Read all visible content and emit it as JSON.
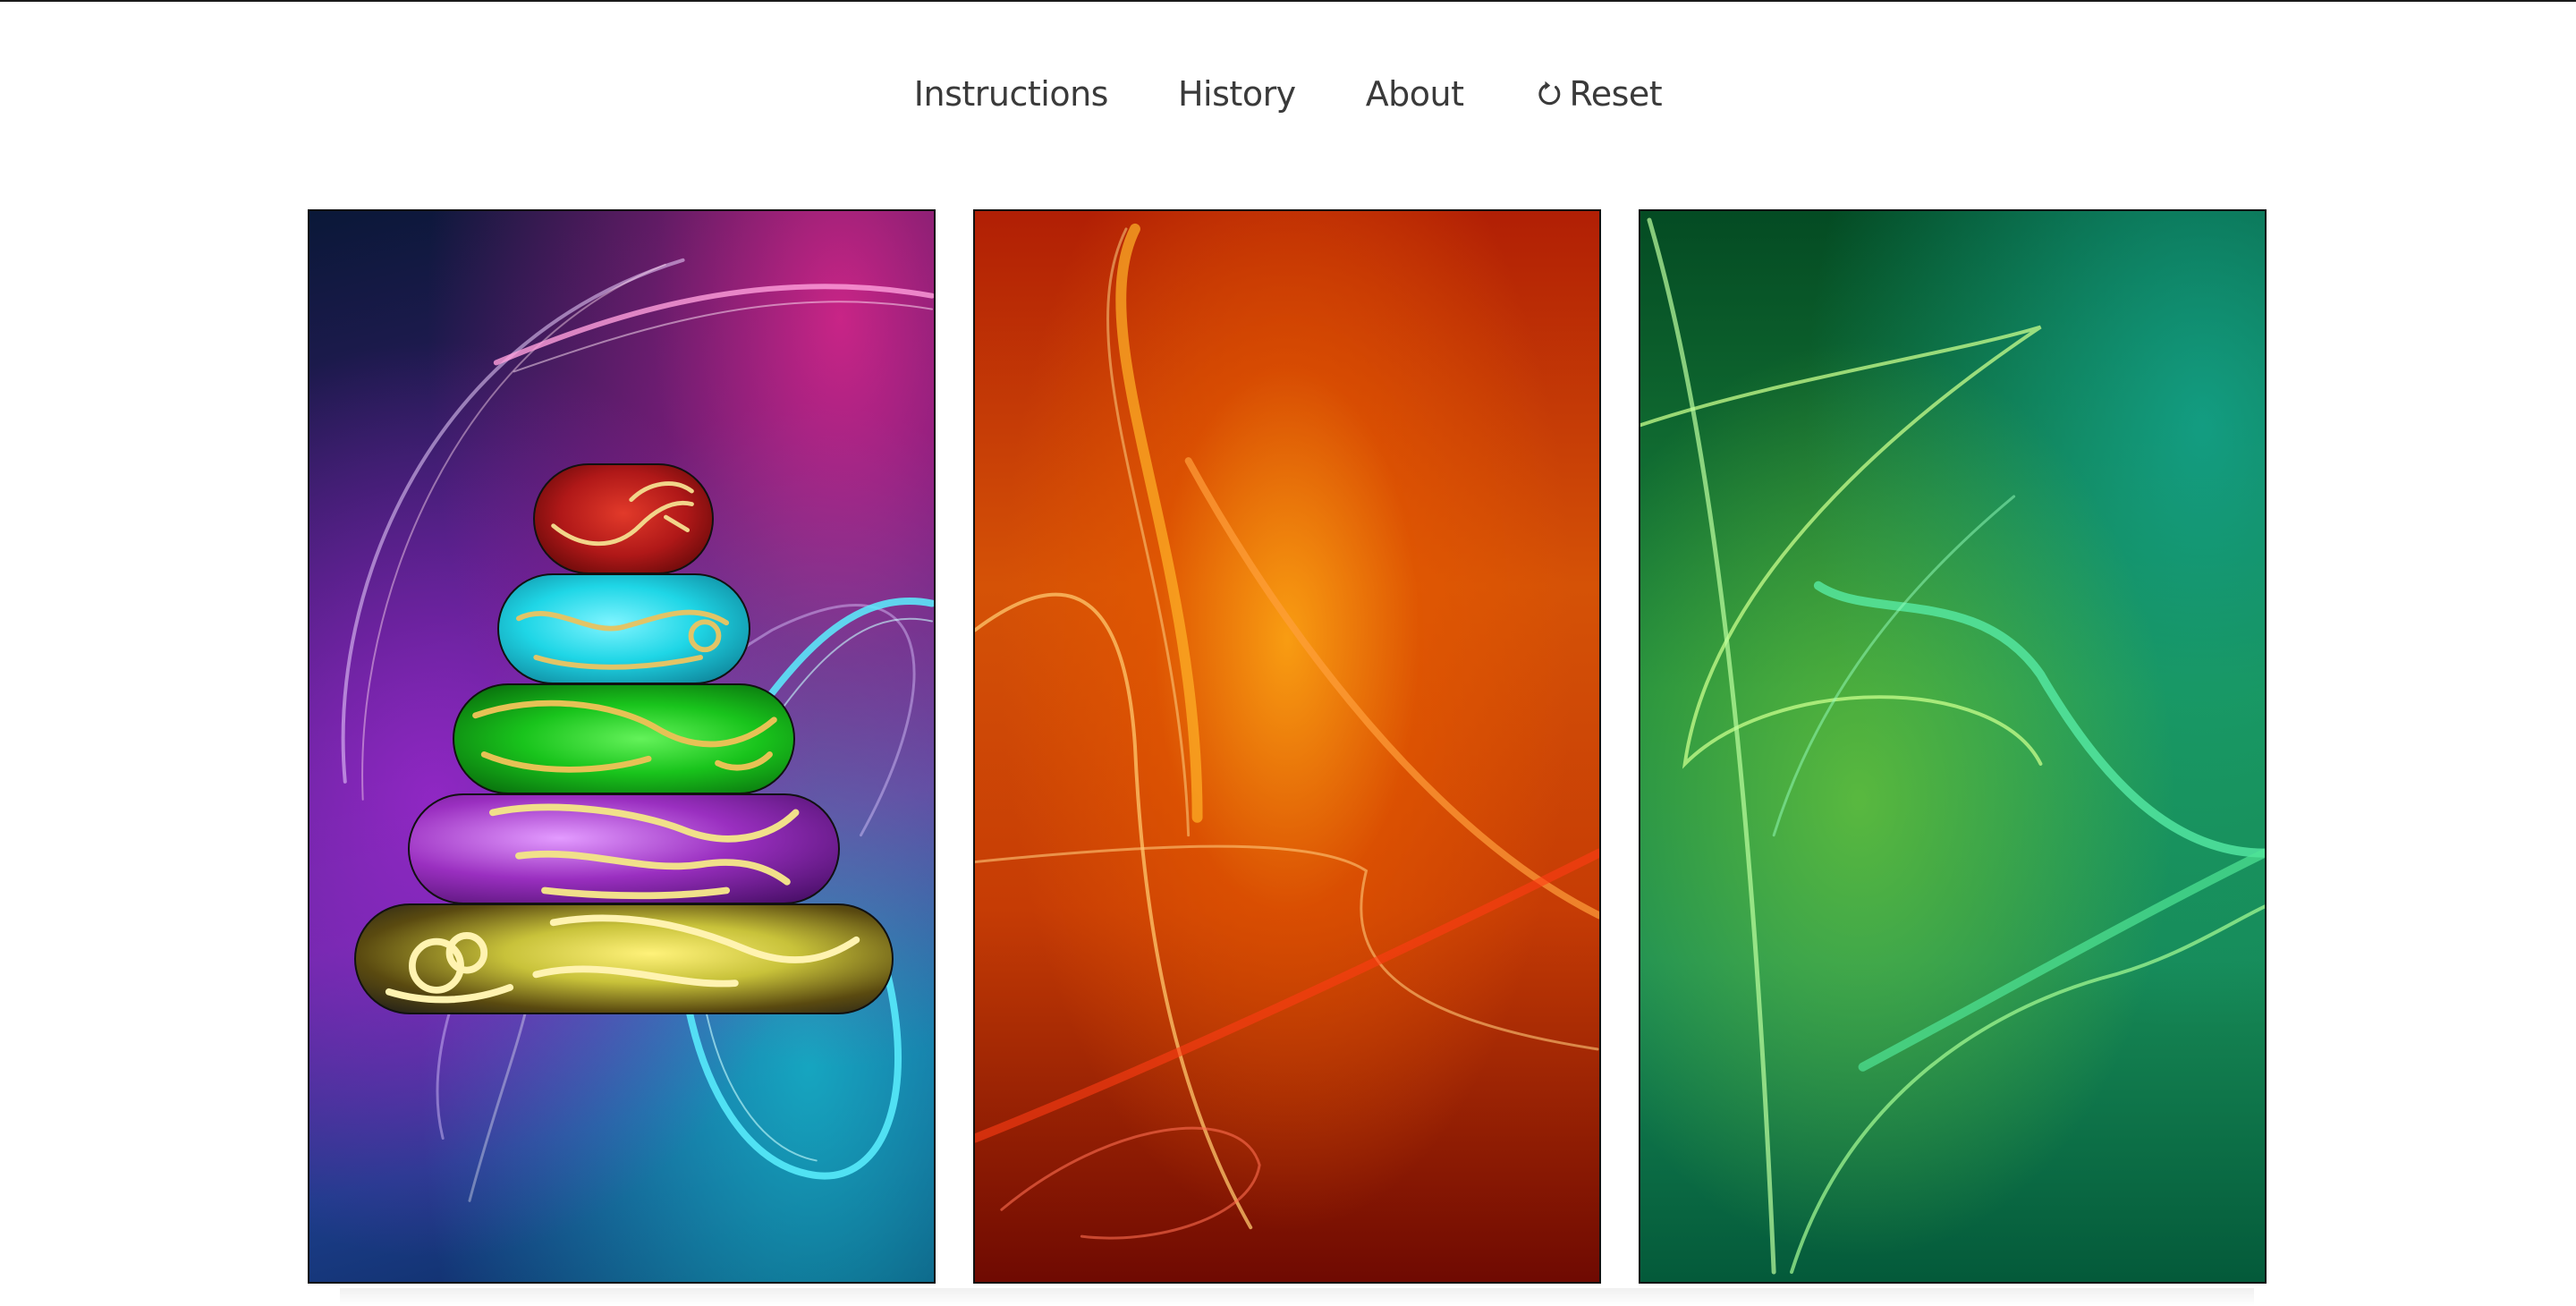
{
  "nav": {
    "items": [
      {
        "label": "Instructions",
        "name": "nav-instructions"
      },
      {
        "label": "History",
        "name": "nav-history"
      },
      {
        "label": "About",
        "name": "nav-about"
      }
    ],
    "reset_label": "Reset",
    "reset_icon": "reset-icon"
  },
  "game": {
    "pegs": [
      {
        "theme": "purple-blue",
        "disks": [
          1,
          2,
          3,
          4,
          5
        ]
      },
      {
        "theme": "orange-red",
        "disks": []
      },
      {
        "theme": "green",
        "disks": []
      }
    ],
    "disk_colors": {
      "1": "#b01818",
      "2": "#1fd6e6",
      "3": "#19c41c",
      "4": "#9a2fc0",
      "5": "#c8c23a"
    },
    "disk_pattern": "dragon"
  }
}
